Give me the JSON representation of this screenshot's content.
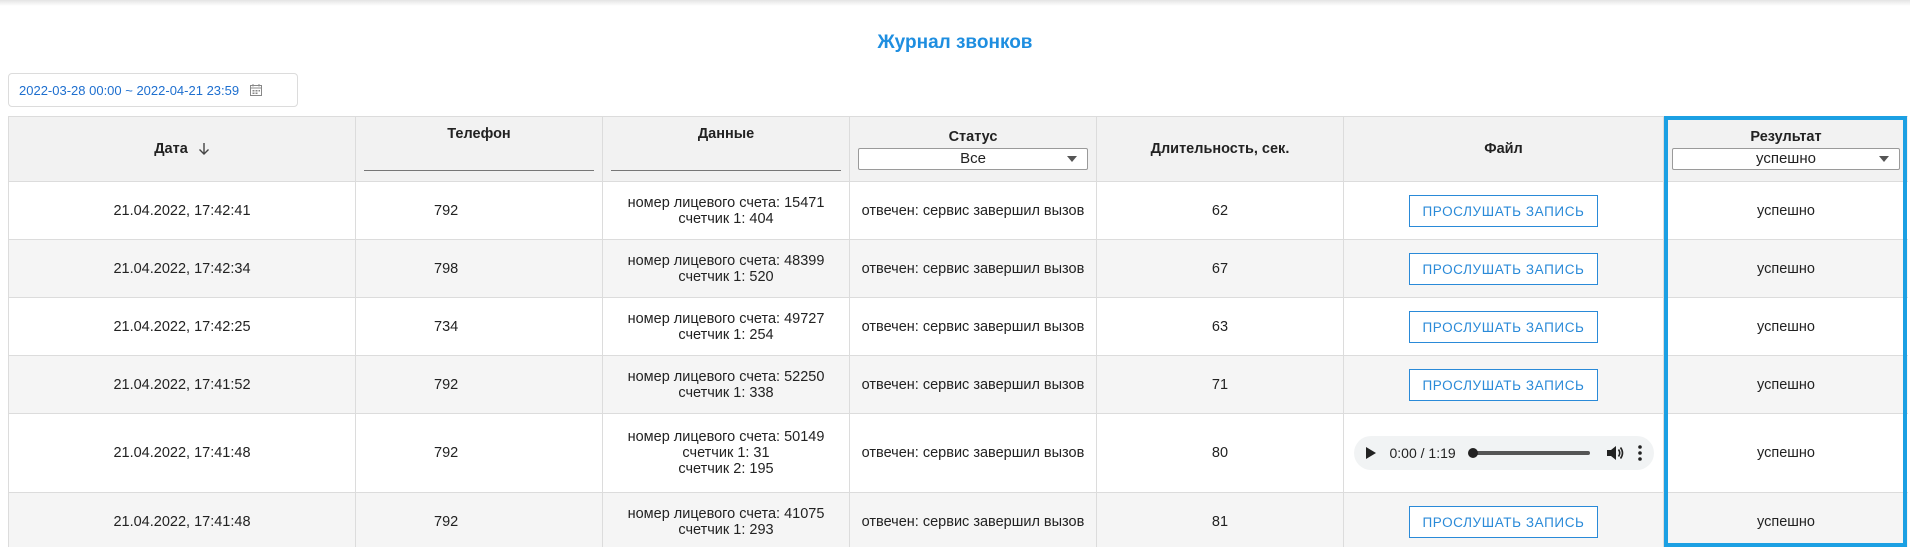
{
  "page": {
    "title": "Журнал звонков"
  },
  "filter": {
    "date_range": "2022-03-28 00:00 ~ 2022-04-21 23:59"
  },
  "columns": {
    "date": "Дата",
    "phone": "Телефон",
    "data": "Данные",
    "status": "Статус",
    "duration": "Длительность, сек.",
    "file": "Файл",
    "result": "Результат"
  },
  "filters": {
    "status_selected": "Все",
    "result_selected": "успешно"
  },
  "listen_label": "ПРОСЛУШАТЬ ЗАПИСЬ",
  "player": {
    "time": "0:00 / 1:19",
    "progress": 0
  },
  "rows": [
    {
      "date": "21.04.2022, 17:42:41",
      "phone": "792",
      "data1": "номер лицевого счета: 15471",
      "data2": "счетчик 1: 404",
      "status": "отвечен: сервис завершил вызов",
      "duration": "62",
      "result": "успешно"
    },
    {
      "date": "21.04.2022, 17:42:34",
      "phone": "798",
      "data1": "номер лицевого счета: 48399",
      "data2": "счетчик 1: 520",
      "status": "отвечен: сервис завершил вызов",
      "duration": "67",
      "result": "успешно"
    },
    {
      "date": "21.04.2022, 17:42:25",
      "phone": "734",
      "data1": "номер лицевого счета: 49727",
      "data2": "счетчик 1: 254",
      "status": "отвечен: сервис завершил вызов",
      "duration": "63",
      "result": "успешно"
    },
    {
      "date": "21.04.2022, 17:41:52",
      "phone": "792",
      "data1": "номер лицевого счета: 52250",
      "data2": "счетчик 1: 338",
      "status": "отвечен: сервис завершил вызов",
      "duration": "71",
      "result": "успешно"
    },
    {
      "date": "21.04.2022, 17:41:48",
      "phone": "792",
      "data1": "номер лицевого счета: 50149",
      "data2": "счетчик 1: 31",
      "data3": "счетчик 2: 195",
      "status": "отвечен: сервис завершил вызов",
      "duration": "80",
      "result": "успешно"
    },
    {
      "date": "21.04.2022, 17:41:48",
      "phone": "792",
      "data1": "номер лицевого счета: 41075",
      "data2": "счетчик 1: 293",
      "status": "отвечен: сервис завершил вызов",
      "duration": "81",
      "result": "успешно"
    }
  ]
}
